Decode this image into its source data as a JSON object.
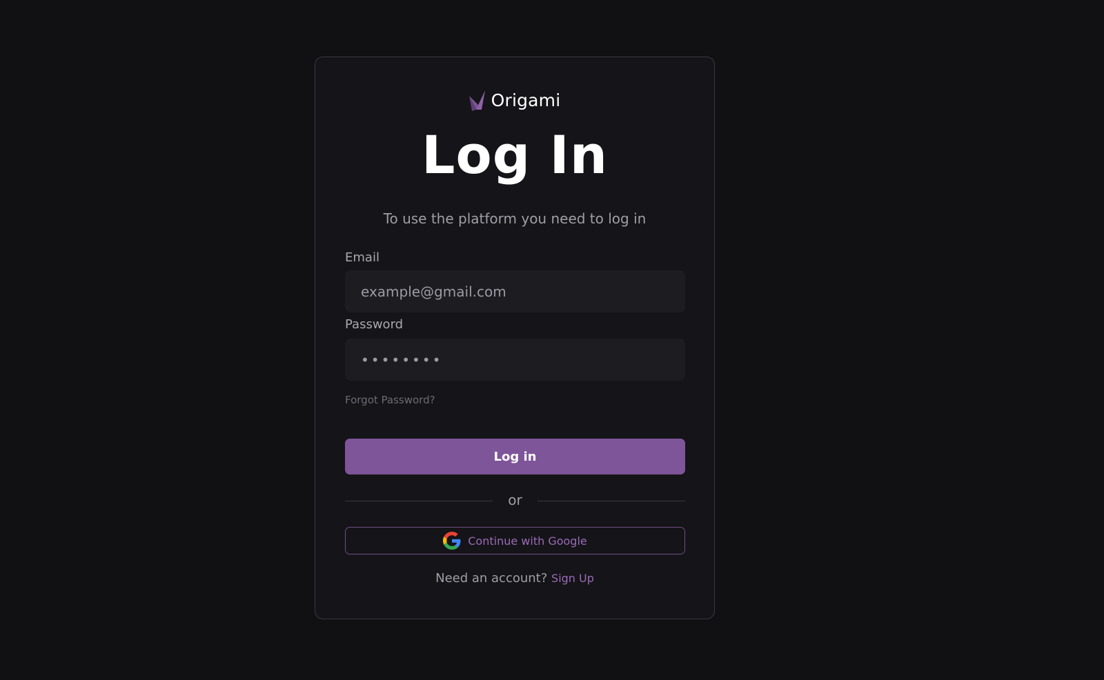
{
  "brand": {
    "name": "Origami",
    "logo_icon": "origami-crane-icon",
    "logo_color": "#7f5599"
  },
  "page": {
    "title": "Log In",
    "subtitle": "To use the platform you need to log in"
  },
  "form": {
    "email_label": "Email",
    "email_placeholder": "example@gmail.com",
    "email_value": "",
    "password_label": "Password",
    "password_value": "••••••••",
    "forgot_password": "Forgot Password?",
    "submit_label": "Log in",
    "divider_text": "or",
    "google_label": "Continue with Google",
    "google_icon": "google-icon"
  },
  "footer": {
    "prompt": "Need an account?",
    "signup_label": "Sign Up"
  },
  "colors": {
    "background": "#111113",
    "card": "#151418",
    "accent": "#7f5599",
    "accent_text": "#9a6bb8"
  }
}
